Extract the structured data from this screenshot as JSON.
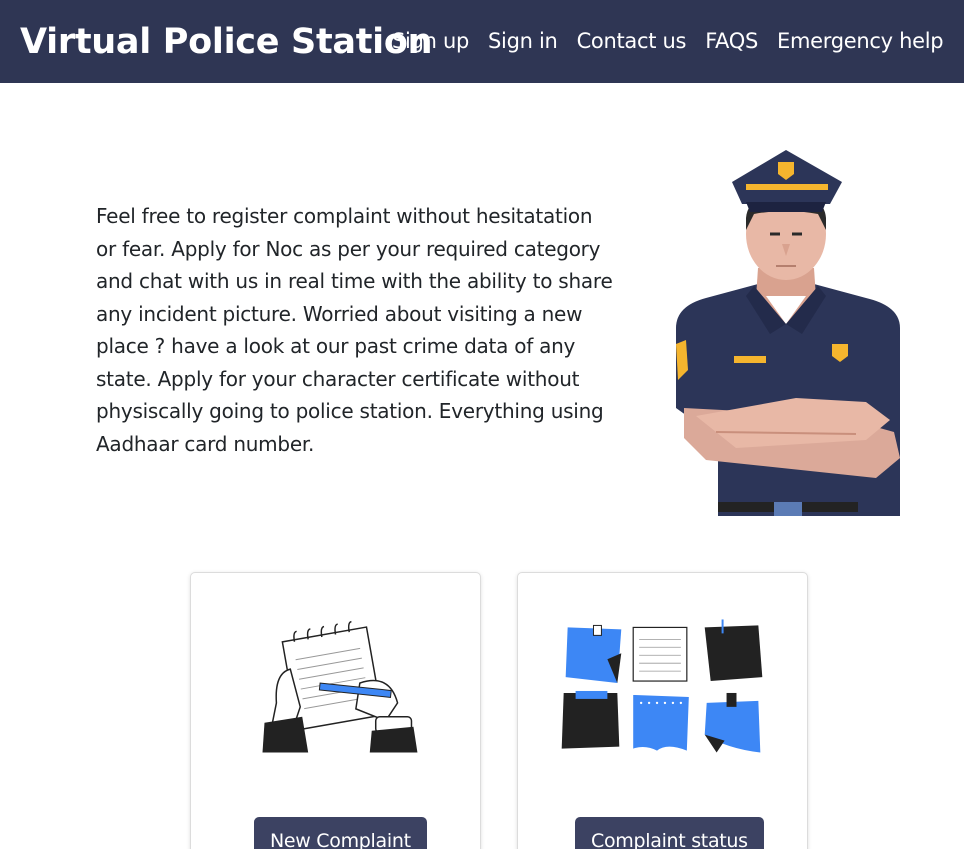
{
  "header": {
    "brand": "Virtual Police Station",
    "nav": [
      {
        "label": "Sign up"
      },
      {
        "label": "Sign in"
      },
      {
        "label": "Contact us"
      },
      {
        "label": "FAQS"
      },
      {
        "label": "Emergency help"
      }
    ]
  },
  "intro": {
    "text": "Feel free to register complaint without hesitatation or fear. Apply for Noc as per your required category and chat with us in real time with the ability to share any incident picture. Worried about visiting a new place ? have a look at our past crime data of any state. Apply for your character certificate without physiscally going to police station. Everything using Aadhaar card number."
  },
  "cards": [
    {
      "button_label": "New Complaint",
      "illustration": "notepad-writing-icon"
    },
    {
      "button_label": "Complaint status",
      "illustration": "sticky-notes-icon"
    }
  ],
  "colors": {
    "navbar": "#2f3654",
    "button": "#3c4262",
    "accent_blue": "#3d87f5",
    "uniform": "#2c3558",
    "badge": "#f5b52e"
  },
  "icons": {
    "hero": "police-officer-icon"
  }
}
